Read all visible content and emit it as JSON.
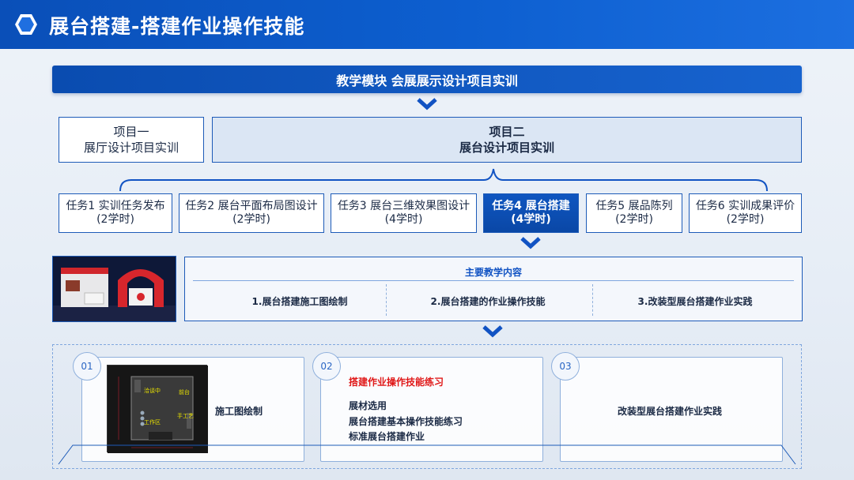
{
  "header": {
    "title": "展台搭建-搭建作业操作技能",
    "icon": "hexagon-icon"
  },
  "module": {
    "label": "教学模块 会展展示设计项目实训"
  },
  "projects": [
    {
      "line1": "项目一",
      "line2": "展厅设计项目实训"
    },
    {
      "line1": "项目二",
      "line2": "展台设计项目实训"
    }
  ],
  "tasks": [
    {
      "name": "任务1 实训任务发布",
      "hours": "(2学时)"
    },
    {
      "name": "任务2 展台平面布局图设计",
      "hours": "(2学时)"
    },
    {
      "name": "任务3 展台三维效果图设计",
      "hours": "(4学时)"
    },
    {
      "name": "任务4 展台搭建",
      "hours": "(4学时)"
    },
    {
      "name": "任务5 展品陈列",
      "hours": "(2学时)"
    },
    {
      "name": "任务6 实训成果评价",
      "hours": "(2学时)"
    }
  ],
  "content": {
    "title": "主要教学内容",
    "items": [
      "1.展台搭建施工图绘制",
      "2.展台搭建的作业操作技能",
      "3.改装型展台搭建作业实践"
    ]
  },
  "cards": [
    {
      "num": "01",
      "text": "施工图绘制"
    },
    {
      "num": "02",
      "heading": "搭建作业操作技能练习",
      "lines": [
        "展材选用",
        "展台搭建基本操作技能练习",
        "标准展台搭建作业"
      ]
    },
    {
      "num": "03",
      "text": "改装型展台搭建作业实践"
    }
  ],
  "plan_labels": [
    "洽谈中",
    "前台",
    "手工艺",
    "工作区"
  ],
  "colors": {
    "primary": "#0d5fd0",
    "accent_red": "#e01818",
    "border": "#1d5bb8"
  }
}
